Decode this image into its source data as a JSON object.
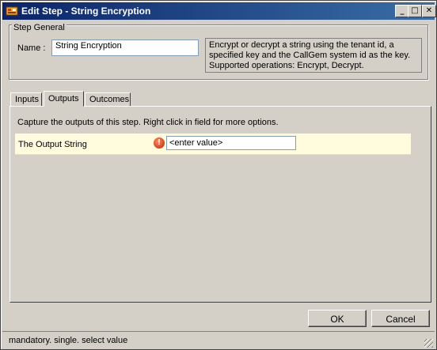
{
  "window": {
    "title": "Edit Step - String Encryption",
    "controls": {
      "minimize": "_",
      "maximize": "□",
      "close": "✕"
    }
  },
  "step_general": {
    "legend": "Step General",
    "name_label": "Name :",
    "name_value": "String Encryption",
    "description": "Encrypt or decrypt a string using the tenant id, a specified key and the CallGem system id as the key. Supported operations: Encrypt, Decrypt."
  },
  "tabs": [
    {
      "label": "Inputs"
    },
    {
      "label": "Outputs"
    },
    {
      "label": "Outcomes"
    }
  ],
  "outputs_panel": {
    "info": "Capture the outputs of this step.  Right click in field for more options.",
    "rows": [
      {
        "label": "The Output String",
        "value": "<enter value>",
        "status_icon": "error-icon"
      }
    ]
  },
  "buttons": {
    "ok": "OK",
    "cancel": "Cancel"
  },
  "status": {
    "text": "mandatory. single. select value"
  },
  "colors": {
    "titlebar": "#0a246a",
    "row_highlight": "#fffbdd",
    "error": "#c81e00"
  }
}
